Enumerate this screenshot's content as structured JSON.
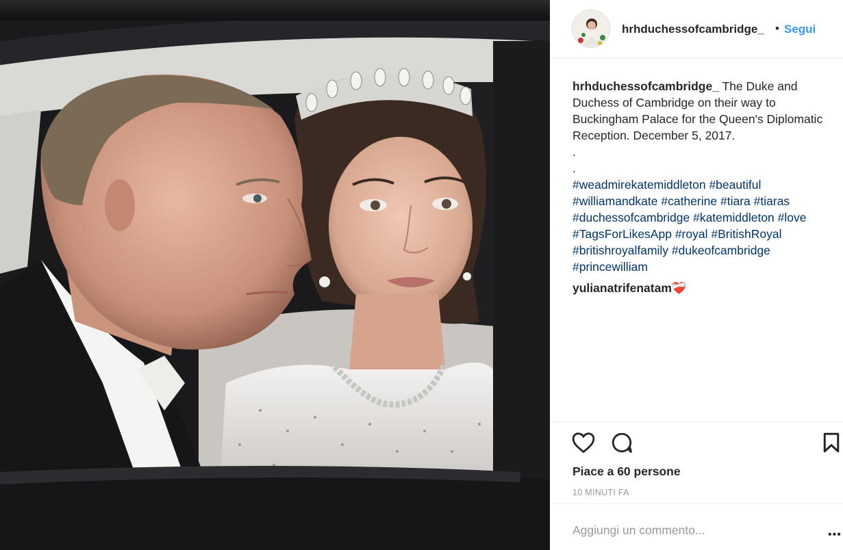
{
  "post": {
    "username": "hrhduchessofcambridge_",
    "dot": "•",
    "follow_label": "Segui",
    "caption_user": "hrhduchessofcambridge_",
    "caption_text": "The Duke and Duchess of Cambridge on their way to Buckingham Palace for the Queen's Diplomatic Reception. December 5, 2017.",
    "caption_dot1": ".",
    "caption_dot2": ".",
    "hashtags": [
      "#weadmirekatemiddleton",
      "#beautiful",
      "#williamandkate",
      "#catherine",
      "#tiara",
      "#tiaras",
      "#duchessofcambridge",
      "#katemiddleton",
      "#love",
      "#TagsForLikesApp",
      "#royal",
      "#BritishRoyal",
      "#britishroyalfamily",
      "#dukeofcambridge",
      "#princewilliam"
    ],
    "comments": [
      {
        "user": "yulianatrifenatam",
        "text": "❤️‍🩹"
      }
    ],
    "likes_text": "Piace a 60 persone",
    "time_text": "10 MINUTI FA",
    "comment_placeholder": "Aggiungi un commento...",
    "more_glyph": "•••"
  },
  "icons": {
    "like": "heart-icon",
    "comment": "speech-bubble-icon",
    "save": "bookmark-icon",
    "more": "more-options-icon"
  },
  "colors": {
    "link_blue": "#3897f0",
    "hashtag": "#003569",
    "text": "#262626",
    "muted": "#999999",
    "divider": "#efefef"
  }
}
